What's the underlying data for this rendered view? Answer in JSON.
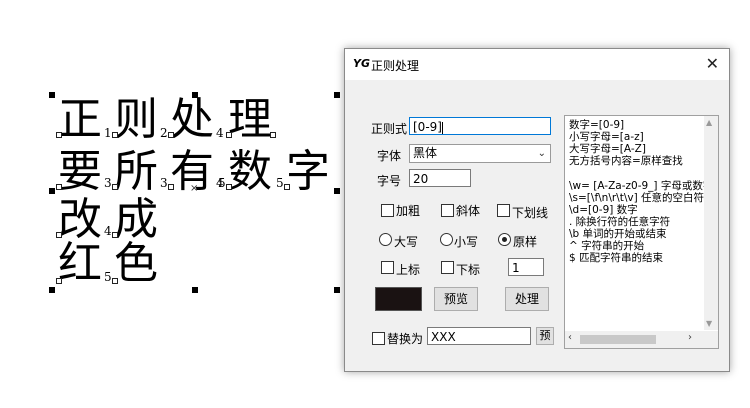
{
  "canvas": {
    "rows": [
      {
        "chars": [
          "正",
          "则",
          "处",
          "理"
        ],
        "subs": [
          "1",
          "2",
          "4"
        ]
      },
      {
        "chars": [
          "要",
          "所",
          "有",
          "数",
          "字"
        ],
        "subs": [
          "3",
          "3",
          "4",
          "5",
          "5"
        ]
      },
      {
        "chars": [
          "改",
          "成"
        ],
        "subs": [
          "4"
        ]
      },
      {
        "chars": [
          "红",
          "色"
        ],
        "subs": [
          "5"
        ]
      }
    ]
  },
  "dialog": {
    "logo": "YG",
    "title": "正则处理",
    "close_label": "✕",
    "regex_label": "正则式",
    "regex_value": "[0-9]",
    "font_label": "字体",
    "font_value": "黑体",
    "size_label": "字号",
    "size_value": "20",
    "bold_label": "加粗",
    "italic_label": "斜体",
    "underline_label": "下划线",
    "upper_label": "大写",
    "lower_label": "小写",
    "original_label": "原样",
    "superscript_label": "上标",
    "subscript_label": "下标",
    "script_value": "1",
    "preview_label": "预览",
    "process_label": "处理",
    "replace_label": "替换为",
    "replace_value": "XXX",
    "replace_btn_label": "预",
    "swatch_color": "#1a1212",
    "help_lines": [
      "数字=[0-9]",
      "小写字母=[a-z]",
      "大写字母=[A-Z]",
      "无方括号内容=原样查找",
      "",
      "\\w= [A-Za-z0-9_] 字母或数字",
      "\\s=[\\f\\n\\r\\t\\v] 任意的空白符",
      "\\d=[0-9] 数字",
      ". 除换行符的任意字符",
      "\\b 单词的开始或结束",
      "^ 字符串的开始",
      "$ 匹配字符串的结束"
    ]
  }
}
